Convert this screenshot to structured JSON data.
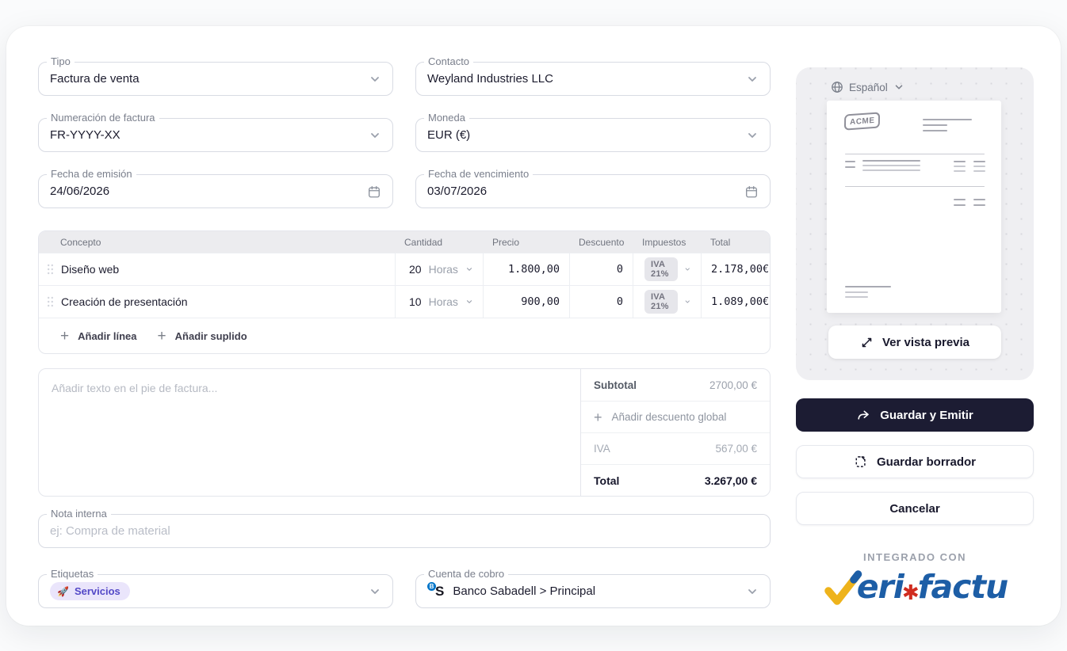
{
  "form": {
    "tipo": {
      "label": "Tipo",
      "value": "Factura de venta"
    },
    "contacto": {
      "label": "Contacto",
      "value": "Weyland Industries LLC"
    },
    "numeracion": {
      "label": "Numeración de factura",
      "value": "FR-YYYY-XX"
    },
    "moneda": {
      "label": "Moneda",
      "value": "EUR (€)"
    },
    "fecha_emision": {
      "label": "Fecha de emisión",
      "value": "24/06/2026"
    },
    "fecha_vencimiento": {
      "label": "Fecha de vencimiento",
      "value": "03/07/2026"
    },
    "nota_interna": {
      "label": "Nota interna",
      "placeholder": "ej: Compra de material"
    },
    "etiquetas": {
      "label": "Etiquetas",
      "tag_emoji": "🚀",
      "tag_label": "Servicios"
    },
    "cuenta_cobro": {
      "label": "Cuenta de cobro",
      "value": "Banco Sabadell > Principal",
      "bank_badge_initial": "B",
      "bank_initial": "S"
    }
  },
  "table": {
    "headers": [
      "Concepto",
      "Cantidad",
      "Precio",
      "Descuento",
      "Impuestos",
      "Total"
    ],
    "rows": [
      {
        "concepto": "Diseño web",
        "cantidad": "20",
        "unidad": "Horas",
        "precio": "1.800,00",
        "descuento": "0",
        "impuesto": "IVA 21%",
        "total": "2.178,00€"
      },
      {
        "concepto": "Creación de presentación",
        "cantidad": "10",
        "unidad": "Horas",
        "precio": "900,00",
        "descuento": "0",
        "impuesto": "IVA 21%",
        "total": "1.089,00€"
      }
    ],
    "plus": "+",
    "add_line": "Añadir línea",
    "add_suplido": "Añadir suplido"
  },
  "footer": {
    "note_placeholder": "Añadir texto en el pie de factura...",
    "plus": "+",
    "subtotal_label": "Subtotal",
    "subtotal_value": "2700,00 €",
    "add_discount": "Añadir descuento global",
    "iva_label": "IVA",
    "iva_value": "567,00 €",
    "total_label": "Total",
    "total_value": "3.267,00 €"
  },
  "sidebar": {
    "language": "Español",
    "preview_doc_brand": "ACME",
    "preview_button": "Ver vista previa",
    "save_emit_button": "Guardar y Emitir",
    "save_draft_button": "Guardar borrador",
    "cancel_button": "Cancelar",
    "integration_caption": "INTEGRADO CON",
    "verifactu": {
      "part1": "eri",
      "asterisk": "✱",
      "part2": "factu"
    }
  },
  "colors": {
    "primary_dark": "#1c1c33",
    "tag_bg": "#eae5fb",
    "tag_text": "#5348c7",
    "table_header_bg": "#ececef",
    "verifactu_blue": "#1d5ea6",
    "verifactu_yellow": "#eeb31b",
    "verifactu_red": "#d02c20",
    "sabadell_blue": "#0075c9"
  }
}
